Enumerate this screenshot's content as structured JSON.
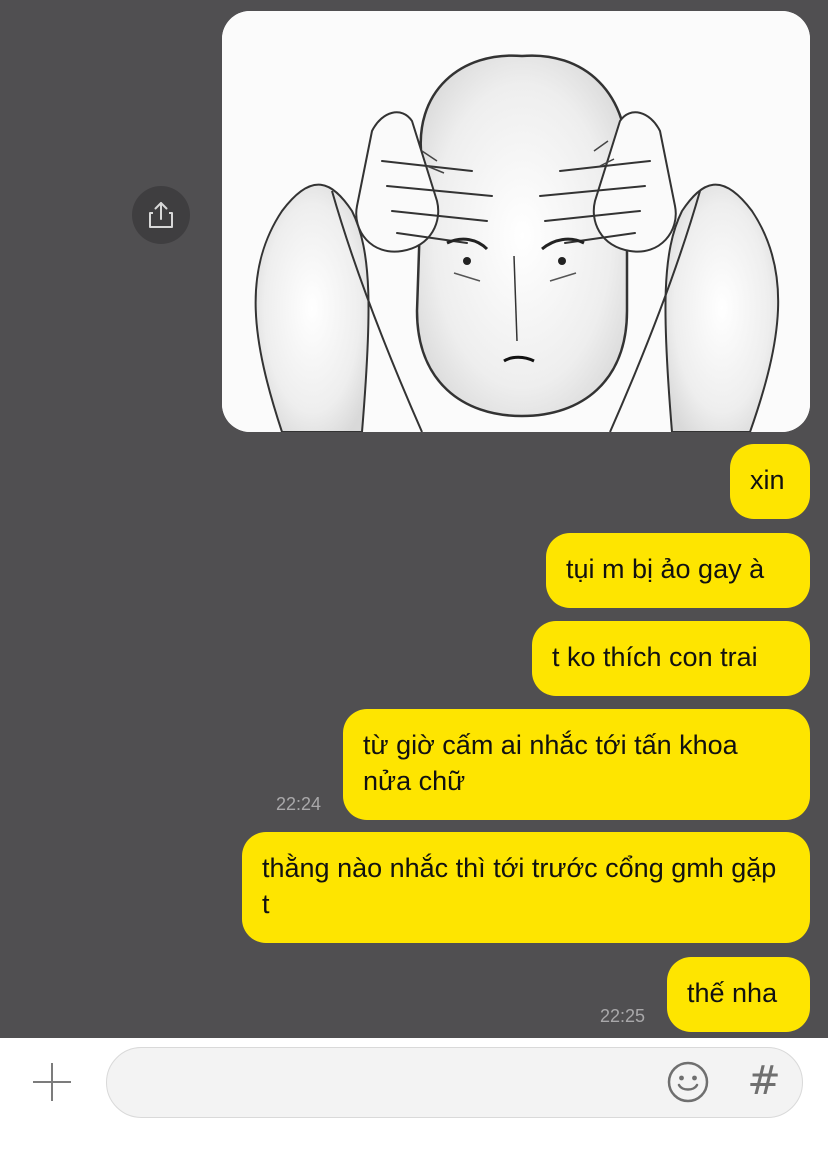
{
  "chat": {
    "messages": [
      {
        "text": "xin"
      },
      {
        "text": "tụi m bị ảo gay à"
      },
      {
        "text": "t ko thích con trai"
      },
      {
        "text": "từ giờ cấm ai nhắc tới tấn khoa nửa chữ",
        "time": "22:24"
      },
      {
        "text": "thằng nào nhắc thì tới trước cổng gmh gặp t"
      },
      {
        "text": "thế nha",
        "time": "22:25"
      }
    ],
    "image": {
      "subject": "meme-drawing-person-holding-head"
    },
    "share_icon": "share-icon"
  },
  "input_bar": {
    "placeholder": "",
    "value": "",
    "plus_icon": "plus-icon",
    "emoji_icon": "emoji-icon",
    "hashtag_label": "#"
  },
  "colors": {
    "chat_background": "#504f51",
    "bubble_sent": "#fee500",
    "input_background": "#ffffff"
  }
}
